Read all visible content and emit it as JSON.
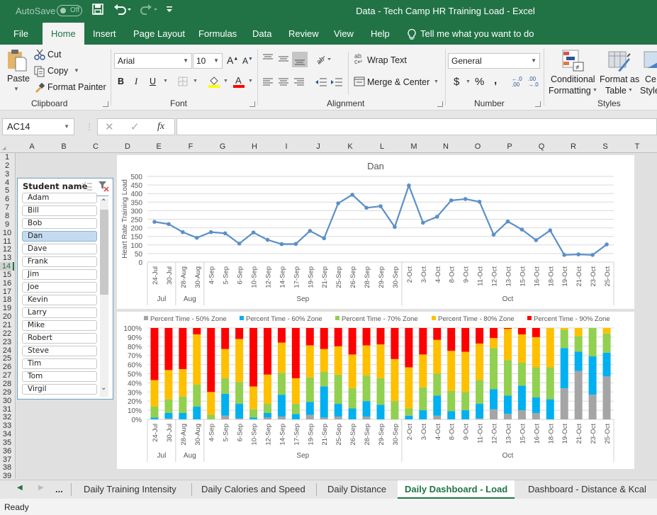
{
  "titlebar": {
    "autosave_label": "AutoSave",
    "autosave_state": "Off",
    "title": "Data - Tech Camp HR Training Load  -  Excel"
  },
  "menu": {
    "tabs": [
      "File",
      "Home",
      "Insert",
      "Page Layout",
      "Formulas",
      "Data",
      "Review",
      "View",
      "Help"
    ],
    "active": "Home",
    "tell_me": "Tell me what you want to do"
  },
  "ribbon": {
    "clipboard": {
      "paste": "Paste",
      "cut": "Cut",
      "copy": "Copy",
      "format_painter": "Format Painter",
      "label": "Clipboard"
    },
    "font": {
      "family": "Arial",
      "size": "10",
      "label": "Font",
      "fill_color": "#ffff00",
      "font_color": "#ff0000"
    },
    "alignment": {
      "wrap_text": "Wrap Text",
      "merge_center": "Merge & Center",
      "label": "Alignment"
    },
    "number": {
      "format": "General",
      "currency": "$",
      "percent": "%",
      "comma": ",",
      "label": "Number"
    },
    "styles": {
      "conditional_1": "Conditional",
      "conditional_2": "Formatting",
      "format_table_1": "Format as",
      "format_table_2": "Table",
      "cell_styles_1": "Ce",
      "cell_styles_2": "Style",
      "label": "Styles"
    }
  },
  "formula_bar": {
    "name_box": "AC14",
    "fx": "fx",
    "formula": ""
  },
  "grid": {
    "columns": [
      "A",
      "B",
      "C",
      "D",
      "E",
      "F",
      "G",
      "H",
      "I",
      "J",
      "K",
      "L",
      "M",
      "N",
      "O",
      "P",
      "Q",
      "R",
      "S",
      "T"
    ],
    "rows": [
      "1",
      "2",
      "3",
      "4",
      "5",
      "6",
      "7",
      "8",
      "9",
      "10",
      "11",
      "12",
      "13",
      "14",
      "15",
      "16",
      "17",
      "18",
      "19",
      "20",
      "21",
      "22",
      "23",
      "24",
      "25",
      "26",
      "27",
      "28",
      "29",
      "30",
      "31",
      "32",
      "33",
      "34",
      "35",
      "36",
      "37",
      "38",
      "39"
    ],
    "selected_row": "14"
  },
  "slicer": {
    "title": "Student name",
    "items": [
      "Adam",
      "Bill",
      "Bob",
      "Dan",
      "Dave",
      "Frank",
      "Jim",
      "Joe",
      "Kevin",
      "Larry",
      "Mike",
      "Robert",
      "Steve",
      "Tim",
      "Tom",
      "Virgil"
    ],
    "selected": "Dan"
  },
  "sheet_tabs": {
    "ellipsis": "...",
    "tabs": [
      "Daily Training Intensity",
      "Daily Calories and Speed",
      "Daily Distance",
      "Daily Dashboard - Load",
      "Dashboard - Distance & Kcal"
    ],
    "active": "Daily Dashboard - Load"
  },
  "status": {
    "text": "Ready"
  },
  "chart_data": [
    {
      "type": "line",
      "title": "Dan",
      "xlabel": "",
      "ylabel": "Heart Rate Training Load",
      "ylim": [
        0,
        500
      ],
      "yticks": [
        0,
        50,
        100,
        150,
        200,
        250,
        300,
        350,
        400,
        450,
        500
      ],
      "grid": true,
      "color": "#5b8fc7",
      "categories": [
        "24-Jul",
        "30-Jul",
        "28-Aug",
        "30-Aug",
        "4-Sep",
        "5-Sep",
        "6-Sep",
        "10-Sep",
        "12-Sep",
        "14-Sep",
        "17-Sep",
        "19-Sep",
        "21-Sep",
        "25-Sep",
        "26-Sep",
        "28-Sep",
        "29-Sep",
        "30-Sep",
        "2-Oct",
        "3-Oct",
        "4-Oct",
        "8-Oct",
        "9-Oct",
        "11-Oct",
        "12-Oct",
        "13-Oct",
        "15-Oct",
        "16-Oct",
        "18-Oct",
        "19-Oct",
        "21-Oct",
        "23-Oct",
        "25-Oct"
      ],
      "groups": [
        {
          "label": "Jul",
          "count": 2
        },
        {
          "label": "Aug",
          "count": 2
        },
        {
          "label": "Sep",
          "count": 14
        },
        {
          "label": "Oct",
          "count": 15
        }
      ],
      "values": [
        235,
        222,
        175,
        142,
        175,
        168,
        108,
        173,
        130,
        105,
        106,
        182,
        139,
        343,
        393,
        317,
        326,
        205,
        447,
        230,
        265,
        360,
        368,
        352,
        160,
        237,
        190,
        128,
        185,
        42,
        45,
        42,
        103
      ]
    },
    {
      "type": "bar",
      "stacked": "percent",
      "legend": "top",
      "ylim": [
        0,
        100
      ],
      "yticks": [
        "0%",
        "10%",
        "20%",
        "30%",
        "40%",
        "50%",
        "60%",
        "70%",
        "80%",
        "90%",
        "100%"
      ],
      "grid": true,
      "categories": [
        "24-Jul",
        "30-Jul",
        "28-Aug",
        "30-Aug",
        "4-Sep",
        "5-Sep",
        "6-Sep",
        "10-Sep",
        "12-Sep",
        "14-Sep",
        "17-Sep",
        "19-Sep",
        "21-Sep",
        "25-Sep",
        "26-Sep",
        "28-Sep",
        "29-Sep",
        "30-Sep",
        "2-Oct",
        "3-Oct",
        "4-Oct",
        "8-Oct",
        "9-Oct",
        "11-Oct",
        "12-Oct",
        "13-Oct",
        "15-Oct",
        "16-Oct",
        "18-Oct",
        "19-Oct",
        "21-Oct",
        "23-Oct",
        "25-Oct"
      ],
      "groups": [
        {
          "label": "Jul",
          "count": 2
        },
        {
          "label": "Aug",
          "count": 2
        },
        {
          "label": "Sep",
          "count": 14
        },
        {
          "label": "Oct",
          "count": 15
        }
      ],
      "series": [
        {
          "name": "Percent Time - 50% Zone",
          "color": "#a5a5a5",
          "values": [
            0,
            1,
            0,
            0,
            0,
            4,
            1,
            0,
            2,
            3,
            0,
            5,
            2,
            3,
            0,
            3,
            0,
            0,
            0,
            0,
            4,
            0,
            0,
            1,
            11,
            6,
            10,
            7,
            0,
            34,
            53,
            27,
            47
          ]
        },
        {
          "name": "Percent Time - 60% Zone",
          "color": "#00b0f0",
          "values": [
            2,
            6,
            7,
            14,
            0,
            24,
            16,
            2,
            5,
            24,
            6,
            14,
            34,
            14,
            12,
            17,
            16,
            0,
            4,
            10,
            22,
            9,
            10,
            16,
            22,
            20,
            27,
            17,
            22,
            44,
            21,
            42,
            26
          ]
        },
        {
          "name": "Percent Time - 70% Zone",
          "color": "#92d050",
          "values": [
            12,
            15,
            18,
            24,
            5,
            17,
            24,
            9,
            10,
            24,
            11,
            27,
            16,
            32,
            22,
            28,
            29,
            20,
            8,
            25,
            24,
            22,
            20,
            26,
            45,
            39,
            25,
            33,
            35,
            20,
            17,
            31,
            21
          ]
        },
        {
          "name": "Percent Time - 80% Zone",
          "color": "#ffc000",
          "values": [
            29,
            32,
            30,
            55,
            25,
            32,
            47,
            25,
            32,
            33,
            28,
            35,
            25,
            31,
            37,
            33,
            37,
            46,
            45,
            36,
            37,
            44,
            44,
            40,
            11,
            34,
            31,
            33,
            43,
            2,
            9,
            0,
            6
          ]
        },
        {
          "name": "Percent Time - 90% Zone",
          "color": "#ff0000",
          "values": [
            57,
            46,
            45,
            7,
            70,
            23,
            12,
            64,
            51,
            16,
            55,
            19,
            23,
            20,
            29,
            19,
            18,
            34,
            43,
            29,
            13,
            25,
            26,
            17,
            11,
            1,
            7,
            10,
            0,
            0,
            0,
            0,
            0
          ]
        }
      ]
    }
  ]
}
